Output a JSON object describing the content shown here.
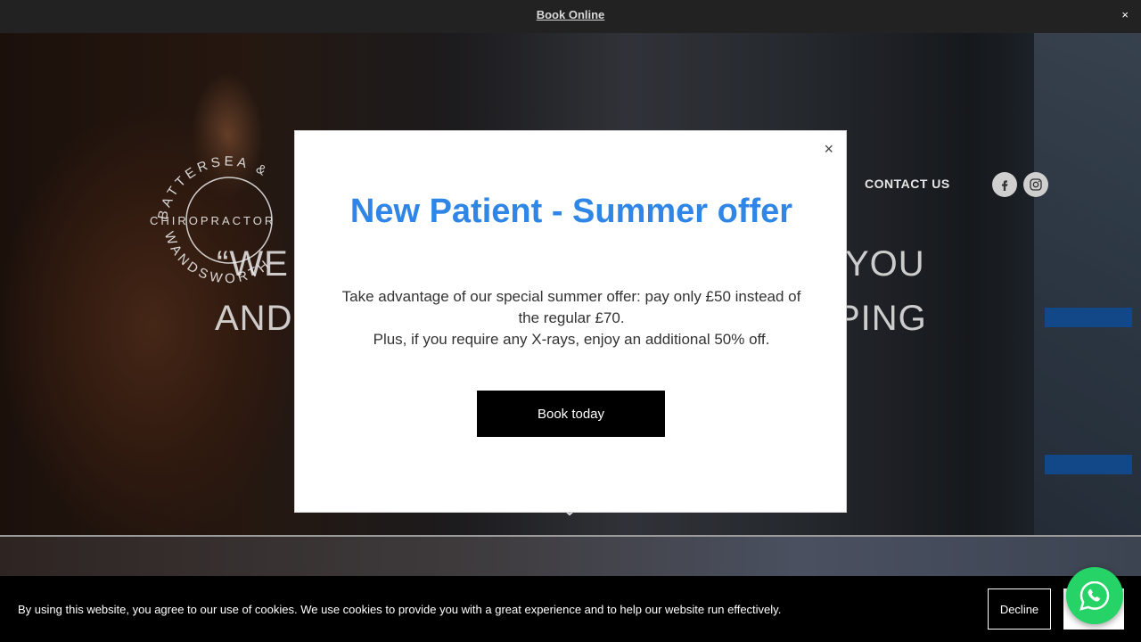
{
  "topbar": {
    "link_label": "Book Online",
    "close_glyph": "×"
  },
  "logo": {
    "top_text": "BATTERSEA &",
    "middle_text": "CHIROPRACTOR",
    "bottom_text": "WANDSWORTH"
  },
  "nav": {
    "contact_label": "CONTACT US"
  },
  "social": {
    "facebook_icon": "facebook-icon",
    "instagram_icon": "instagram-icon"
  },
  "hero": {
    "line1_left": "“WE",
    "line2_left": "AND",
    "line1_right": "YOU",
    "line2_right": "PING"
  },
  "modal": {
    "close_glyph": "×",
    "title": "New Patient - Summer offer",
    "body_line1": "Take advantage of our special summer offer: pay only £50 instead of the regular £70.",
    "body_line2": "Plus, if you require any X-rays, enjoy an additional 50% off.",
    "button_label": "Book today"
  },
  "cookie": {
    "text": "By using this website, you agree to our use of cookies. We use cookies to provide you with a great experience and to help our website run effectively.",
    "decline_label": "Decline",
    "accept_label": ""
  },
  "colors": {
    "accent_blue": "#2f86e6",
    "whatsapp_green": "#25d366",
    "topbar_bg": "#222222"
  }
}
